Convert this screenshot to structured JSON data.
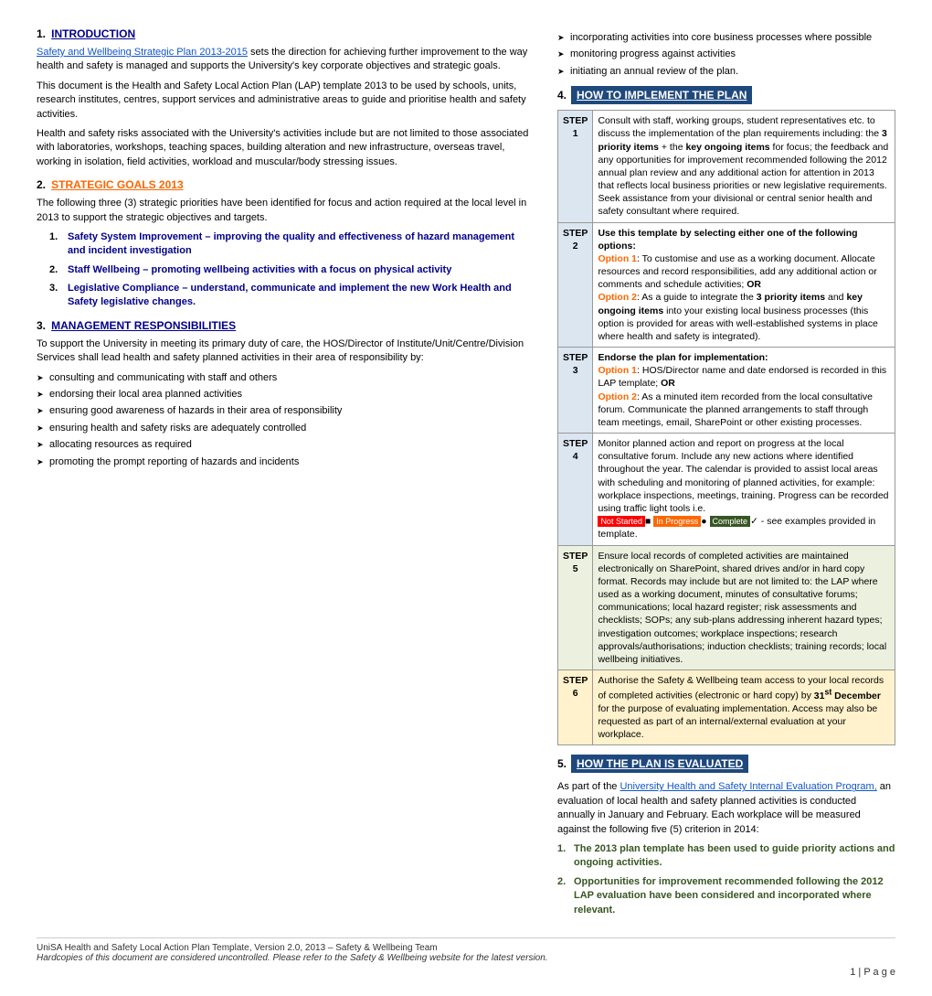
{
  "page": {
    "title": "Health and Safety Local Action Plan Template",
    "sections": {
      "intro": {
        "number": "1.",
        "heading": "INTRODUCTION",
        "link_text": "Safety and Wellbeing Strategic Plan 2013-2015",
        "para1": "sets the direction for achieving further improvement to the way health and safety is managed and supports the University's key corporate objectives and strategic goals.",
        "para2": "This document is the Health and Safety Local Action Plan (LAP) template 2013 to be used by schools, units, research institutes, centres, support services and administrative areas to guide and prioritise health and safety activities.",
        "para3": "Health and safety risks associated with the University's activities include but are not limited to those associated with laboratories, workshops, teaching spaces, building alteration and new infrastructure, overseas travel, working in isolation, field activities, workload and muscular/body stressing issues."
      },
      "strategic": {
        "number": "2.",
        "heading": "STRATEGIC GOALS 2013",
        "intro": "The following three (3) strategic priorities have been identified for focus and action required at the local level in 2013 to support the strategic objectives and targets.",
        "items": [
          {
            "label": "Safety System Improvement – improving the quality and effectiveness of hazard management and incident investigation"
          },
          {
            "label": "Staff Wellbeing – promoting wellbeing activities with a focus on physical activity"
          },
          {
            "label": "Legislative Compliance – understand, communicate and implement the new Work Health and Safety legislative changes."
          }
        ]
      },
      "management": {
        "number": "3.",
        "heading": "MANAGEMENT RESPONSIBILITIES",
        "para1": "To support the University in meeting its primary duty of care, the HOS/Director of Institute/Unit/Centre/Division Services shall lead health and safety planned activities in their area of responsibility by:",
        "bullets": [
          "consulting and communicating with staff and others",
          "endorsing their local area planned activities",
          "ensuring good awareness of hazards in their area of responsibility",
          "ensuring health and safety risks are adequately controlled",
          "allocating resources as required",
          "promoting the prompt reporting of hazards and incidents"
        ]
      }
    },
    "right_column": {
      "bullets": [
        "incorporating activities into core business processes where possible",
        "monitoring progress against activities",
        "initiating an annual review of the plan."
      ],
      "implement_heading": "HOW TO IMPLEMENT THE PLAN",
      "steps": [
        {
          "label": "STEP\n1",
          "content": "Consult with staff, working groups, student representatives etc. to discuss the implementation of the plan requirements including: the 3 priority items + the key ongoing items for focus; the feedback and any opportunities for improvement recommended following the 2012 annual plan review and any additional action for attention in 2013 that reflects local business priorities or new legislative requirements. Seek assistance from your divisional or central senior health and safety consultant where required."
        },
        {
          "label": "STEP\n2",
          "bold_intro": "Use this template by selecting either one of the following options:",
          "opt1_label": "Option 1",
          "opt1_text": ": To customise and use as a working document. Allocate resources and record responsibilities, add any additional action or comments and schedule activities;",
          "or_text": " OR",
          "opt2_label": "Option 2",
          "opt2_text": ": As a guide to integrate the 3 priority items and key ongoing items into your existing local business processes (this option is provided for areas with well-established systems in place where health and safety is integrated)."
        },
        {
          "label": "STEP\n3",
          "bold_intro": "Endorse the plan for implementation:",
          "opt1_label": "Option 1",
          "opt1_text": ": HOS/Director name and date endorsed is recorded in this LAP template;",
          "or_text": " OR",
          "opt2_label": "Option 2",
          "opt2_text": ": As a minuted item recorded from the local consultative forum. Communicate the planned arrangements to staff through team meetings, email, SharePoint or other existing processes."
        },
        {
          "label": "STEP\n4",
          "content": "Monitor planned action and report on progress at the local consultative forum. Include any new actions where identified throughout the year. The calendar is provided to assist local areas with scheduling and monitoring of planned activities, for example: workplace inspections, meetings, training. Progress can be recorded using traffic light tools i.e.",
          "not_started": "Not Started",
          "in_progress": "In Progress",
          "complete": "Complete",
          "suffix": "- see examples provided in template."
        },
        {
          "label": "STEP\n5",
          "content": "Ensure local records of completed activities are maintained electronically on SharePoint, shared drives and/or in hard copy format. Records may include but are not limited to: the LAP where used as a working document, minutes of consultative forums; communications; local hazard register; risk assessments and checklists; SOPs; any sub-plans addressing inherent hazard types; investigation outcomes; workplace inspections; research approvals/authorisations; induction checklists; training records; local wellbeing initiatives.",
          "bg": "green"
        },
        {
          "label": "STEP\n6",
          "content_part1": "Authorise the Safety & Wellbeing team access to your local records of completed activities (electronic or hard copy) by",
          "bold_date": "31st December",
          "content_part2": " for the purpose of evaluating implementation. Access may also be requested as part of an internal/external evaluation at your workplace.",
          "bg": "yellow"
        }
      ],
      "evaluate_heading": "HOW THE PLAN IS EVALUATED",
      "evaluate_intro": "As part of the",
      "evaluate_link": "University Health and Safety Internal Evaluation Program,",
      "evaluate_text": " an evaluation of local health and safety planned activities is conducted annually in January and February. Each workplace will be measured against the following five (5) criterion in 2014:",
      "eval_items": [
        {
          "text": "The 2013 plan template has been used to guide priority actions and ongoing activities.",
          "style": "green"
        },
        {
          "text": "Opportunities for improvement recommended following the 2012 LAP evaluation have been considered and incorporated where relevant.",
          "style": "green"
        }
      ]
    },
    "footer": {
      "line1": "UniSA Health and Safety Local Action Plan Template, Version 2.0, 2013 – Safety & Wellbeing Team",
      "line2": "Hardcopies of this document are considered uncontrolled. Please refer to the Safety & Wellbeing website for the latest version.",
      "page_label": "1 | P a g e"
    }
  }
}
